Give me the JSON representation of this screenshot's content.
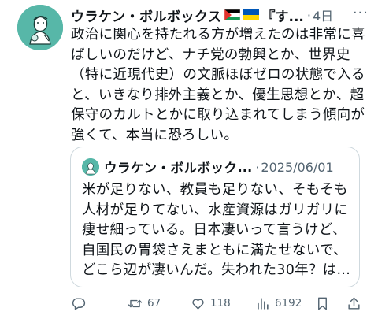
{
  "post": {
    "author_name": "ウラケン・ボルボックス",
    "author_name_tail": "『す...",
    "separator": "·",
    "time": "4日",
    "more_label": "···",
    "flags": [
      "palestine-flag",
      "ukraine-flag"
    ],
    "text": "政治に関心を持たれる方が増えたのは非常に喜ばしいのだけど、ナチ党の勃興とか、世界史（特に近現代史）の文脈ほぼゼロの状態で入ると、いきなり排外主義とか、優生思想とか、超保守のカルトとかに取り込まれてしまう傾向が強くて、本当に恐ろしい。"
  },
  "quote": {
    "author_name": "ウラケン・ボルボック",
    "ellipsis": "...",
    "separator": "·",
    "date": "2025/06/01",
    "text": "米が足りない、教員も足りない、そもそも人材が足りてない、水産資源はガリガリに痩せ細っている。日本凄いって言うけど、自国民の胃袋さえまともに満たせないで、どこら辺が凄いんだ。失われた30年？は..."
  },
  "actions": {
    "reply_icon": "reply-icon",
    "retweets": "67",
    "likes": "118",
    "views": "6192",
    "bookmark_icon": "bookmark-icon",
    "share_icon": "share-icon"
  },
  "colors": {
    "text": "#0f1419",
    "muted": "#536471",
    "border": "#cfd9de",
    "avatar_bg": "#57b7a8"
  }
}
